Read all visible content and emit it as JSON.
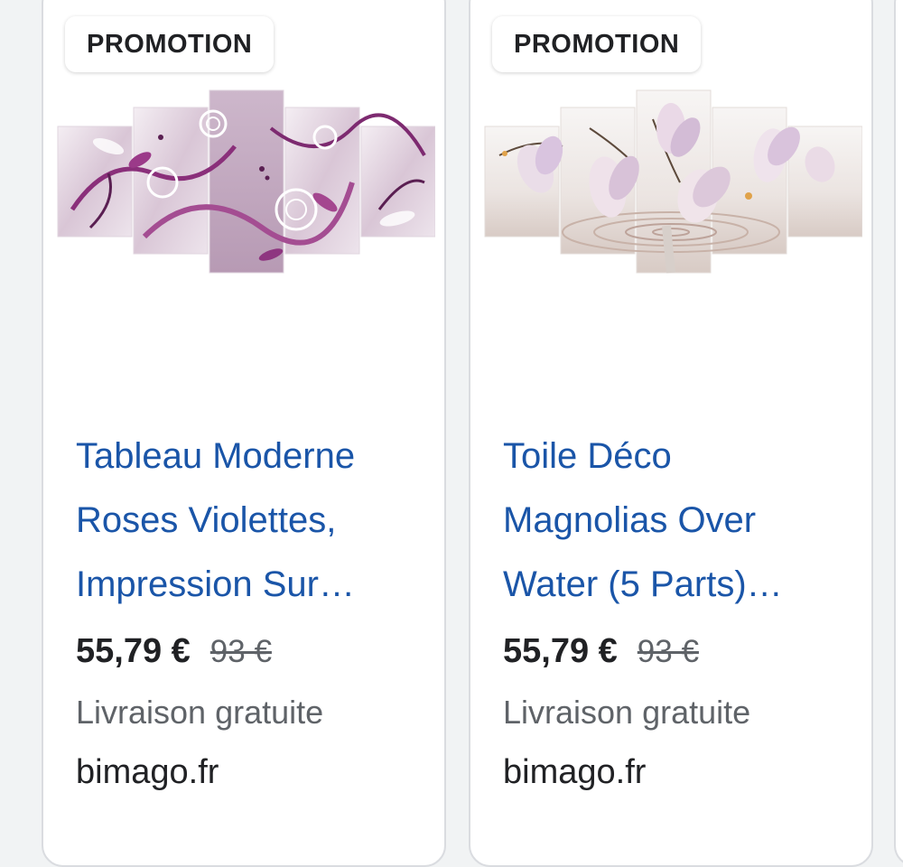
{
  "products": [
    {
      "badge": "PROMOTION",
      "image_alt": "roses-violettes-canvas-set",
      "title": "Tableau Moderne Roses Violettes, Impression Sur…",
      "price": "55,79 €",
      "old_price": "93 €",
      "delivery": "Livraison gratuite",
      "seller": "bimago.fr"
    },
    {
      "badge": "PROMOTION",
      "image_alt": "magnolias-over-water-canvas-set",
      "title": "Toile Déco Magnolias Over Water (5 Parts)…",
      "price": "55,79 €",
      "old_price": "93 €",
      "delivery": "Livraison gratuite",
      "seller": "bimago.fr"
    }
  ],
  "colors": {
    "title_link": "#1a55a8",
    "price": "#202124",
    "muted": "#5f6368",
    "card_border": "#dadce0",
    "background": "#f1f3f4"
  }
}
